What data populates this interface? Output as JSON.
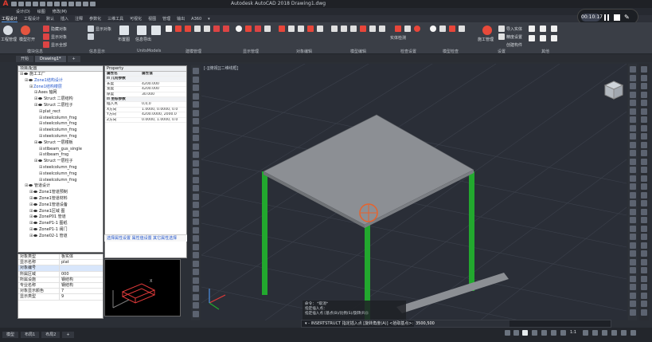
{
  "window": {
    "app_title": "Autodesk AutoCAD 2018   Drawing1.dwg"
  },
  "menubar": [
    "设计(D)",
    "绘图",
    "修改(M)"
  ],
  "ribbon_tabs": [
    {
      "label": "工程设计",
      "active": true
    },
    {
      "label": "工程设计"
    },
    {
      "label": "默认"
    },
    {
      "label": "插入"
    },
    {
      "label": "注释"
    },
    {
      "label": "参数化"
    },
    {
      "label": "三维工具"
    },
    {
      "label": "可视化"
    },
    {
      "label": "视图"
    },
    {
      "label": "管理"
    },
    {
      "label": "输出"
    },
    {
      "label": "A360"
    },
    {
      "label": "▾"
    }
  ],
  "ribbon": {
    "groups": [
      "模块信息",
      "信息显示",
      "UnitsModels",
      "建模管理",
      "显示管理",
      "对象编辑",
      "模型编辑",
      "检查设置",
      "模型检查",
      "设置",
      "其他"
    ],
    "labels": [
      "工程管理",
      "模型打开",
      "隐藏对象",
      "显示对象",
      "显示全部",
      "显示对象",
      "布置图",
      "信息导出",
      "实体检测",
      "施工管理",
      "导入实体",
      "精度设置",
      "创建构件"
    ]
  },
  "doc_tabs": [
    {
      "label": "开始",
      "active": false
    },
    {
      "label": "Drawing1*",
      "active": true
    }
  ],
  "tree": {
    "header": "项目/配置",
    "rows": [
      {
        "indent": 0,
        "text": "施工工厂",
        "eye": true
      },
      {
        "indent": 1,
        "text": "Zone1结构设计",
        "eye": true,
        "blue": true
      },
      {
        "indent": 2,
        "text": "Zone1结构楼层",
        "eye": false,
        "blue": true
      },
      {
        "indent": 3,
        "text": "Axes 轴网",
        "eye": false
      },
      {
        "indent": 3,
        "text": "Struct 二层结构",
        "eye": true
      },
      {
        "indent": 3,
        "text": "Struct 二层柱子",
        "eye": true
      },
      {
        "indent": 4,
        "text": "plat_rect",
        "eye": false
      },
      {
        "indent": 4,
        "text": "steelcolumn_frsg",
        "eye": false
      },
      {
        "indent": 4,
        "text": "steelcolumn_frsg",
        "eye": false
      },
      {
        "indent": 4,
        "text": "steelcolumn_frsg",
        "eye": false
      },
      {
        "indent": 4,
        "text": "steelcolumn_frsg",
        "eye": false
      },
      {
        "indent": 3,
        "text": "Struct 一层楼板",
        "eye": true
      },
      {
        "indent": 4,
        "text": "stlbeam_gus_single",
        "eye": false
      },
      {
        "indent": 4,
        "text": "stlbeam_frsg",
        "eye": false
      },
      {
        "indent": 3,
        "text": "Struct 一层柱子",
        "eye": true
      },
      {
        "indent": 4,
        "text": "steelcolumn_frsg",
        "eye": false
      },
      {
        "indent": 4,
        "text": "steelcolumn_frsg",
        "eye": false
      },
      {
        "indent": 4,
        "text": "steelcolumn_frsg",
        "eye": false
      },
      {
        "indent": 1,
        "text": "管道设计",
        "eye": true
      },
      {
        "indent": 2,
        "text": "Zone1管道预制",
        "eye": true
      },
      {
        "indent": 2,
        "text": "Zone1管道材料",
        "eye": true
      },
      {
        "indent": 2,
        "text": "Zone1管道设备",
        "eye": true
      },
      {
        "indent": 2,
        "text": "Zone1区域 图",
        "eye": true
      },
      {
        "indent": 2,
        "text": "ZoneP01 管道",
        "eye": true
      },
      {
        "indent": 2,
        "text": "ZoneP1-1 图纸",
        "eye": true
      },
      {
        "indent": 2,
        "text": "ZoneP1-1 阀门",
        "eye": true
      },
      {
        "indent": 2,
        "text": "Zone02-1 管道",
        "eye": true
      }
    ]
  },
  "propgrid": [
    {
      "k": "对象类型",
      "v": "板实体"
    },
    {
      "k": "显示名称",
      "v": "plat"
    },
    {
      "k": "对象编号",
      "v": "",
      "sel": true
    },
    {
      "k": "所属区域",
      "v": "000"
    },
    {
      "k": "所属设施",
      "v": "钢结构"
    },
    {
      "k": "专业名称",
      "v": "钢结构"
    },
    {
      "k": "对象显示颜色",
      "v": "7"
    },
    {
      "k": "显示类型",
      "v": "9"
    }
  ],
  "property": {
    "title": "Property",
    "header_k": "属性名",
    "header_v": "属性值",
    "rows": [
      {
        "sec": true,
        "k": "⊟ 几何参数",
        "v": ""
      },
      {
        "k": "  长度",
        "v": "4200.000"
      },
      {
        "k": "  宽度",
        "v": "4200.000"
      },
      {
        "k": "  厚度",
        "v": "30.000"
      },
      {
        "sec": true,
        "k": "⊟ 坐标参数",
        "v": ""
      },
      {
        "k": "  插入点",
        "v": "0,0,0"
      },
      {
        "k": "  X方向",
        "v": "1.0000, 0.0000, 0.0"
      },
      {
        "k": "  Y方向",
        "v": "4200.0000, 2000.0"
      },
      {
        "k": "  Z方向",
        "v": "0.0000, 1.0000, 0.0"
      }
    ],
    "footer": "选择属性设置   属性值设置   其它属性选择"
  },
  "viewport": {
    "label": "[-][俯视][二维线框]"
  },
  "command": {
    "history": [
      "命令：  *取消*",
      "指定插入点：",
      "指定插入点 [基点(B)/比例(S)/旋转(R)]:"
    ],
    "prompt": "▾ - INSERTSTRUCT 指定插入点 [旋转角度(A)] <拾取基点>:",
    "input_value": "3500,500"
  },
  "status": {
    "tabs": [
      "模型",
      "布局1",
      "布局2"
    ],
    "scale": "1:1"
  },
  "recorder": {
    "time": "00:10:17"
  },
  "colors": {
    "accent": "#4a90e2",
    "column": "#22a82e",
    "slab": "#8c8f94",
    "grid": "#3c414c"
  }
}
